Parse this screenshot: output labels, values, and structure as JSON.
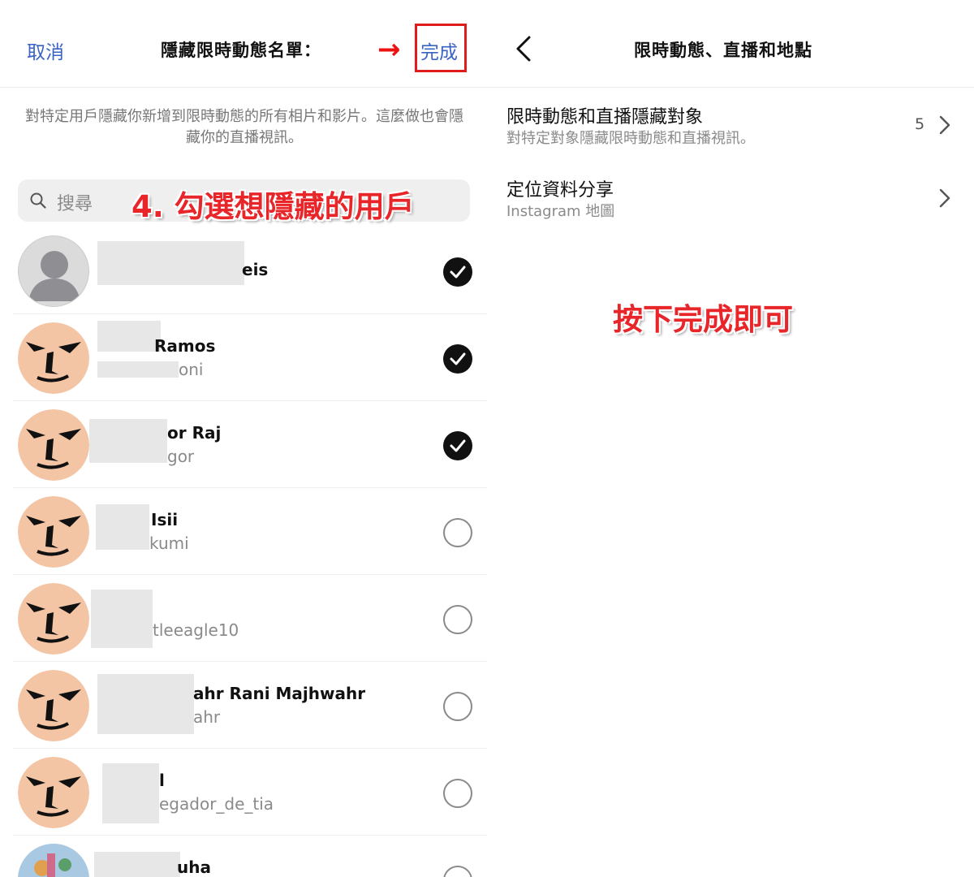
{
  "left_panel": {
    "header": {
      "cancel_label": "取消",
      "title": "隱藏限時動態名單：",
      "arrow_glyph": "→",
      "done_label": "完成"
    },
    "description": "對特定用戶隱藏你新增到限時動態的所有相片和影片。這麼做也會隱藏你的直播視訊。",
    "search": {
      "placeholder": "搜尋",
      "icon": "search-icon"
    },
    "step_annotation": "4. 勾選想隱藏的用戶",
    "users": [
      {
        "name": "eis",
        "handle": "",
        "avatar": "default-person-icon",
        "checked": true
      },
      {
        "name": "Ramos",
        "handle": "oni",
        "avatar": "cartoon-face",
        "checked": true
      },
      {
        "name": "or Raj",
        "handle": "gor",
        "avatar": "cartoon-face",
        "checked": true
      },
      {
        "name": "Isii",
        "handle": "kumi",
        "avatar": "cartoon-face",
        "checked": false
      },
      {
        "name": "",
        "handle": "tleeagle10",
        "avatar": "cartoon-face",
        "checked": false
      },
      {
        "name": "ahr Rani Majhwahr",
        "handle": "ahr",
        "avatar": "cartoon-face",
        "checked": false
      },
      {
        "name": "l",
        "handle": "egador_de_tia",
        "avatar": "cartoon-face",
        "checked": false
      },
      {
        "name": "uha",
        "handle": "",
        "avatar": "colorful-photo",
        "checked": false
      }
    ],
    "colors": {
      "link": "#3a63c4",
      "annotation": "#e8262a",
      "check_on": "#111111"
    }
  },
  "right_panel": {
    "header": {
      "title": "限時動態、直播和地點",
      "back_icon": "chevron-left-icon"
    },
    "items": [
      {
        "title": "限時動態和直播隱藏對象",
        "subtitle": "對特定對象隱藏限時動態和直播視訊。",
        "count": "5"
      },
      {
        "title": "定位資料分享",
        "subtitle": "Instagram 地圖",
        "count": ""
      }
    ],
    "annotation": "按下完成即可"
  }
}
